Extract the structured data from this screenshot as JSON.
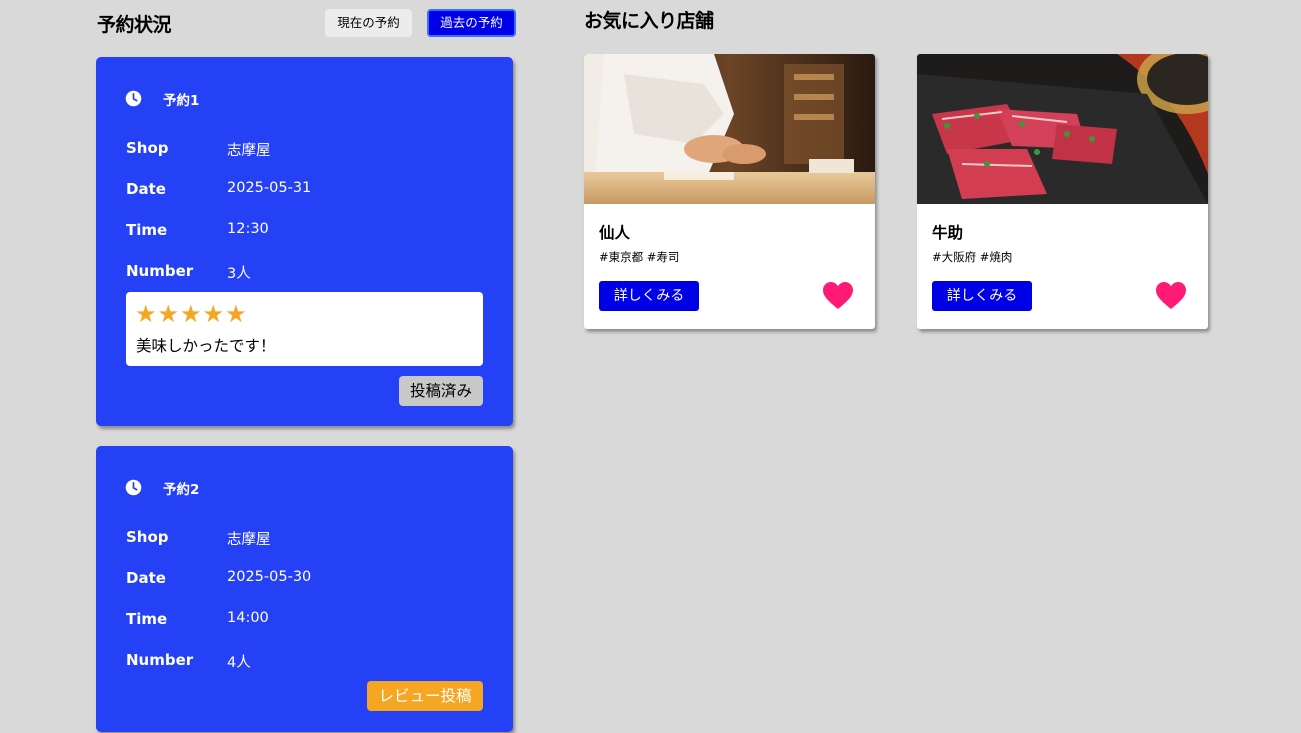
{
  "reservations": {
    "title": "予約状況",
    "tabs": {
      "current": "現在の予約",
      "past": "過去の予約"
    },
    "labels": {
      "shop": "Shop",
      "date": "Date",
      "time": "Time",
      "number": "Number"
    },
    "items": [
      {
        "name": "予約1",
        "shop": "志摩屋",
        "date": "2025-05-31",
        "time": "12:30",
        "number": "3人",
        "review": {
          "rating": 5,
          "stars": "★★★★★",
          "comment": "美味しかったです！"
        },
        "action": "投稿済み"
      },
      {
        "name": "予約2",
        "shop": "志摩屋",
        "date": "2025-05-30",
        "time": "14:00",
        "number": "4人",
        "action": "レビュー投稿"
      }
    ]
  },
  "favorites": {
    "title": "お気に入り店舗",
    "detail_label": "詳しくみる",
    "shops": [
      {
        "name": "仙人",
        "tags": "#東京都 #寿司",
        "image": "sushi-chef-photo",
        "favorited": true
      },
      {
        "name": "牛助",
        "tags": "#大阪府 #焼肉",
        "image": "yakiniku-beef-photo",
        "favorited": true
      }
    ]
  },
  "colors": {
    "background": "#d9d9d9",
    "card_blue": "#2541f5",
    "button_blue": "#0000e6",
    "star_gold": "#f5a623",
    "heart_pink": "#ff1a75",
    "posted_gray": "#c8c8c8"
  }
}
